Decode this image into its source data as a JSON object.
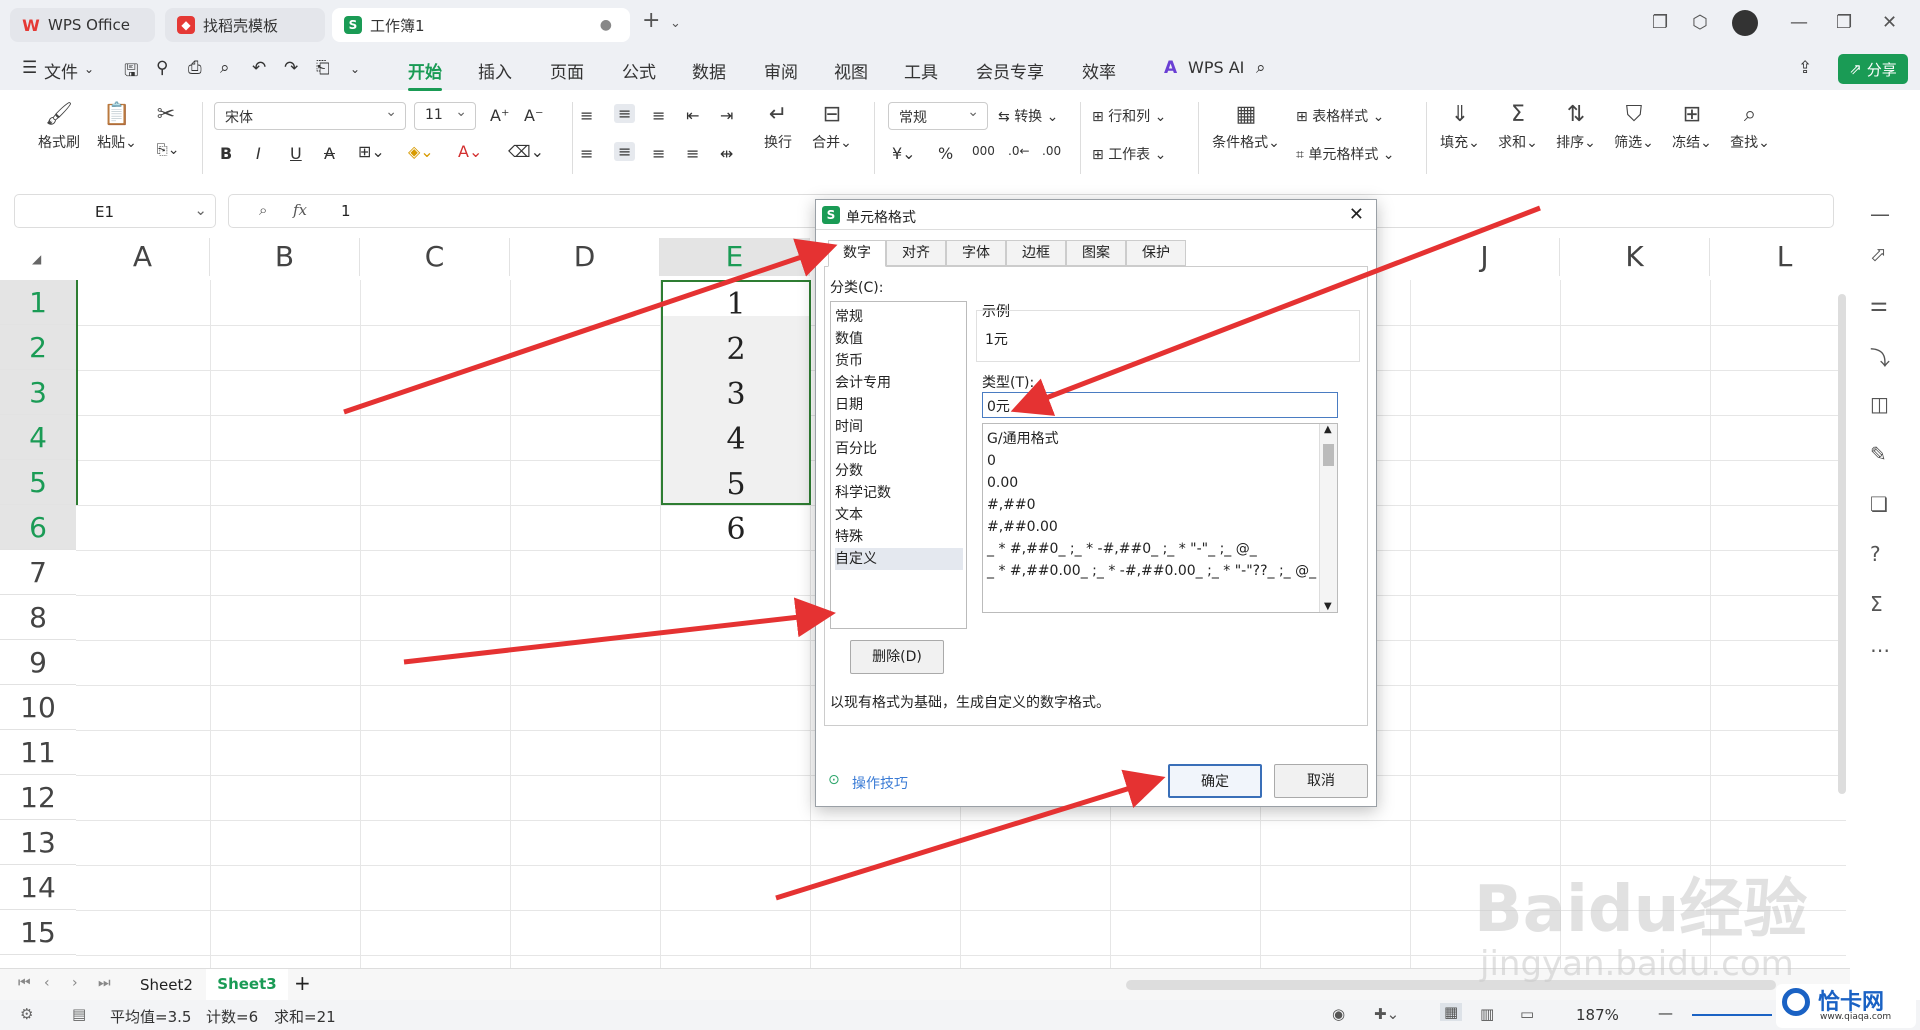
{
  "colors": {
    "accent": "#1a9b55",
    "arrow": "#e53232",
    "selection": "#2e7d32"
  },
  "tabs": {
    "wps": "WPS Office",
    "template": "找稻壳模板",
    "book": "工作簿1"
  },
  "menu": {
    "file": "文件",
    "items": [
      "开始",
      "插入",
      "页面",
      "公式",
      "数据",
      "审阅",
      "视图",
      "工具",
      "会员专享",
      "效率"
    ],
    "wpsai": "WPS AI",
    "share": "分享"
  },
  "ribbon": {
    "format_painter": "格式刷",
    "paste": "粘贴",
    "font_name": "宋体",
    "font_size": "11",
    "wrap": "换行",
    "merge": "合并",
    "number_format": "常规",
    "convert": "转换",
    "rowcol": "行和列",
    "worksheet": "工作表",
    "cond_format": "条件格式",
    "table_style": "表格样式",
    "cell_style": "单元格样式",
    "fill": "填充",
    "sum": "求和",
    "sort": "排序",
    "filter": "筛选",
    "freeze": "冻结",
    "find": "查找"
  },
  "formula": {
    "cell_ref": "E1",
    "fx": "fx",
    "value": "1"
  },
  "grid": {
    "columns": [
      "A",
      "B",
      "C",
      "D",
      "E",
      "",
      "",
      "",
      "J",
      "K",
      "L"
    ],
    "rows": [
      "1",
      "2",
      "3",
      "4",
      "5",
      "6",
      "7",
      "8",
      "9",
      "10",
      "11",
      "12",
      "13",
      "14",
      "15"
    ],
    "cells_E": [
      "1",
      "2",
      "3",
      "4",
      "5",
      "6"
    ]
  },
  "sheets": {
    "tabs": [
      "Sheet2",
      "Sheet3"
    ],
    "active": "Sheet3",
    "add": "+"
  },
  "status": {
    "avg": "平均值=3.5",
    "count": "计数=6",
    "sum": "求和=21",
    "zoom": "187%"
  },
  "dialog": {
    "title": "单元格格式",
    "tabs": [
      "数字",
      "对齐",
      "字体",
      "边框",
      "图案",
      "保护"
    ],
    "category_label": "分类(C):",
    "categories": [
      "常规",
      "数值",
      "货币",
      "会计专用",
      "日期",
      "时间",
      "百分比",
      "分数",
      "科学记数",
      "文本",
      "特殊",
      "自定义"
    ],
    "sample_label": "示例",
    "sample_value": "1元",
    "type_label": "类型(T):",
    "type_value": "0元",
    "formats": [
      "G/通用格式",
      "0",
      "0.00",
      "#,##0",
      "#,##0.00",
      "_ * #,##0_ ;_ * -#,##0_ ;_ * \"-\"_ ;_ @_",
      "_ * #,##0.00_ ;_ * -#,##0.00_ ;_ * \"-\"??_ ;_ @_"
    ],
    "delete_btn": "删除(D)",
    "description": "以现有格式为基础，生成自定义的数字格式。",
    "tips": "操作技巧",
    "ok": "确定",
    "cancel": "取消"
  },
  "watermark": {
    "brand": "Baidu经验",
    "url": "jingyan.baidu.com",
    "corner": "恰卡网",
    "corner_url": "www.qiaqa.com"
  }
}
